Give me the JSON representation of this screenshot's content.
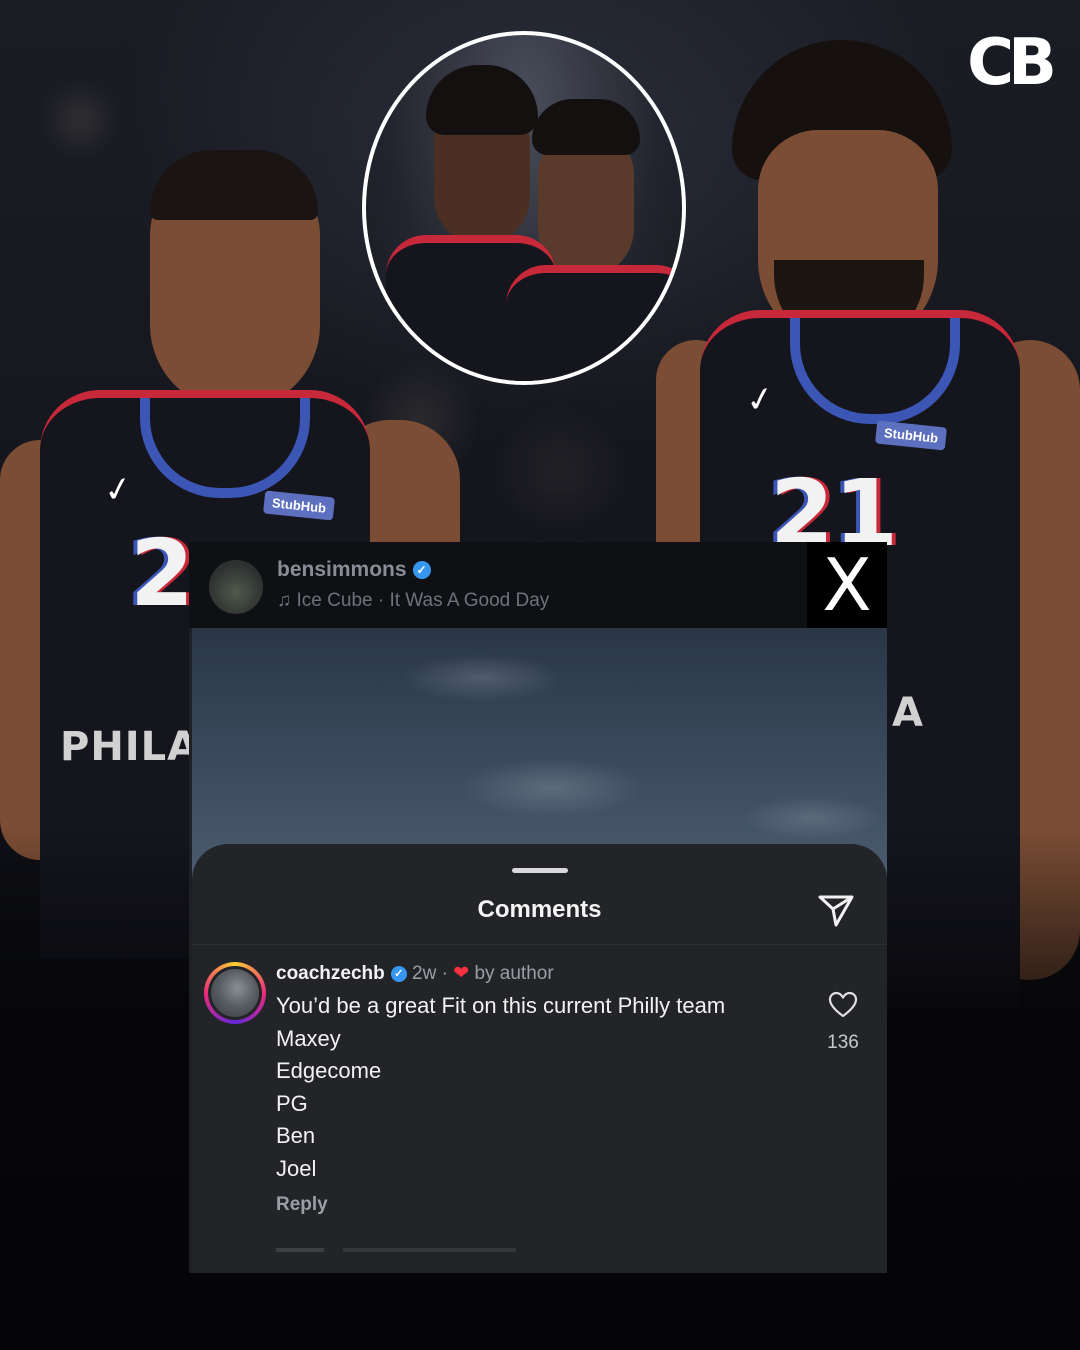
{
  "logo": {
    "text": "CB"
  },
  "post": {
    "username": "bensimmons",
    "song_icon": "♫",
    "song": "Ice Cube · It Was A Good Day",
    "close_label": "X"
  },
  "players": {
    "left_number": "2",
    "right_number": "21",
    "sponsor": "StubHub",
    "left_team_text": "PHILAD",
    "right_team_text": "A"
  },
  "sheet": {
    "title": "Comments",
    "comment": {
      "username": "coachzechb",
      "time": "2w",
      "separator": "·",
      "liked_by": "by author",
      "lines": [
        "You’d be a great Fit on this current Philly team",
        "Maxey",
        "Edgecome",
        "PG",
        "Ben",
        "Joel"
      ],
      "reply_label": "Reply",
      "like_count": "136"
    }
  },
  "colors": {
    "background": "#07080b",
    "card": "#1f2024",
    "verified": "#3797f0",
    "heart": "#ff3040",
    "jersey_red": "#c7283a",
    "jersey_blue": "#3c56b5"
  }
}
